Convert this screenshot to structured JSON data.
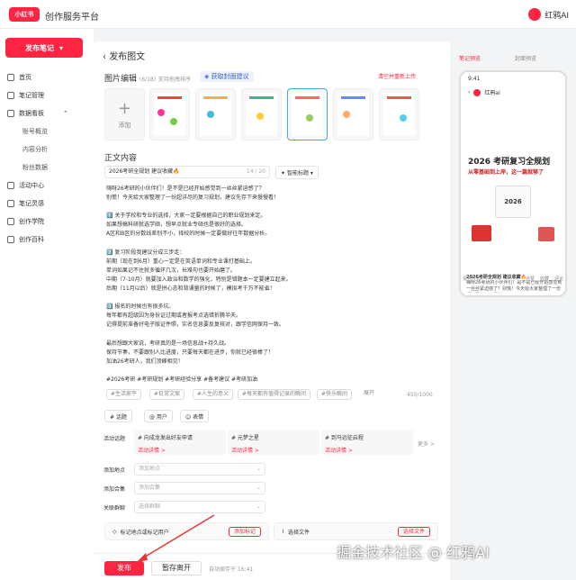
{
  "app": {
    "logo": "小红书",
    "title": "创作服务平台",
    "user": "红鸦AI"
  },
  "sidebar": {
    "publish": "发布笔记",
    "items": [
      "首页",
      "笔记管理",
      "数据看板",
      "账号概览",
      "内容分析",
      "粉丝数据",
      "活动中心",
      "笔记灵感",
      "创作学院",
      "创作百科"
    ]
  },
  "editor": {
    "back_title": "发布图文",
    "images_label": "图片编辑",
    "images_count": "(6/18)",
    "drag_hint": "支持拖拽排序",
    "cover_tip": "获取封面建议",
    "clear_btn": "清空并重新上传",
    "add_label": "添加",
    "body_label": "正文内容",
    "title_value": "2026考研全规划 建议收藏🔥",
    "title_count": "14 / 20",
    "smart_title": "智能标题",
    "body": "嗨呀26考研的小伙伴们！是不是已经开始感觉到一丝丝紧迫感了？\n别慌！今天给大家整理了一份超详尽的复习规划，建议先存下来慢慢看！\n\n1️⃣ 关于学校和专业的选择，大家一定要根据自己的职业规划来定。\n如果想搞科研就选学硕，想早点就业专硕也是很好的选择。\nA区和B区的分数线差别不小，择校的时候一定要做好往年数据分析。\n\n2️⃣ 复习阶段我建议分成三步走：\n前期（现在到6月）重心一定是在英语单词和专业课打基础上。\n单词如果记不住就多循环几次，长难句也要开始磨了。\n中期（7-10月）就要加入政治和数学的强化，特别是错题本一定要建立起来。\n后期（11月以后）就是拼心态和背诵量的时候了，模拟考千万不能省！\n\n3️⃣ 报名的时候也有很多坑。\n每年都有超级因为身份证过期或者报考点选错折腾半天。\n记得提前准备好电子版证件照，实名信息要反复核对，跟学信网保持一致。\n\n最后想跟大家说，考研真的是一场信息战+持久战。\n保持节奏，不要跟别人比进度，只要每天都在进步，你就已经很棒了！\n加油26考研人，我们顶峰相见！\n\n#2026考研 #考研规划 #考研经验分享 #备考建议 #考研加油",
    "chips": [
      "#生活家平",
      "#日常文案",
      "#人生的意义",
      "#每天都有值得记录的瞬间",
      "#快乐瞬间",
      "展开"
    ],
    "char_count": "455/1000",
    "tools": [
      "# 话题",
      "@ 用户",
      "☺ 表情"
    ],
    "activity_label": "活动话题",
    "activities": [
      {
        "t": "# 向成龙发出好友申请",
        "s": "活动详情 >"
      },
      {
        "t": "# 元梦之星",
        "s": "活动详情 >"
      },
      {
        "t": "# 到马远征启程",
        "s": "活动详情 >"
      }
    ],
    "more": "更多 >",
    "location_label": "添加地点",
    "location_ph": "添加地点",
    "collection_label": "添加合集",
    "collection_ph": "添加合集",
    "group_label": "关联群聊",
    "group_ph": "选择群聊",
    "mark_text": "标记地点或标记用户",
    "mark_btn": "添加标记",
    "file_text": "选择文件",
    "file_btn": "选择文件"
  },
  "footer": {
    "publish": "发布",
    "draft": "暂存离开",
    "autosave": "自动保存于 16:41"
  },
  "preview": {
    "tab_note": "笔记预览",
    "tab_cover": "封面预览",
    "time": "9:41",
    "account": "红鸦ai",
    "cover_title": "2026 考研复习全规划",
    "cover_sub": "从零基础到上岸，这一篇就够了",
    "cover_badge": "2026",
    "post_title": "2026考研全规划 建议收藏🔥",
    "post_text": "嗨呀26考研的小伙伴们！是不是已经开始感觉到一丝丝紧迫感了？别慌！今天给大家整理了一份超详尽的复习规划",
    "comment": "说点什么",
    "likes": "点赞",
    "stars": "收藏",
    "cm": "评论"
  },
  "watermark": "掘金技术社区 @ 红鸦AI"
}
